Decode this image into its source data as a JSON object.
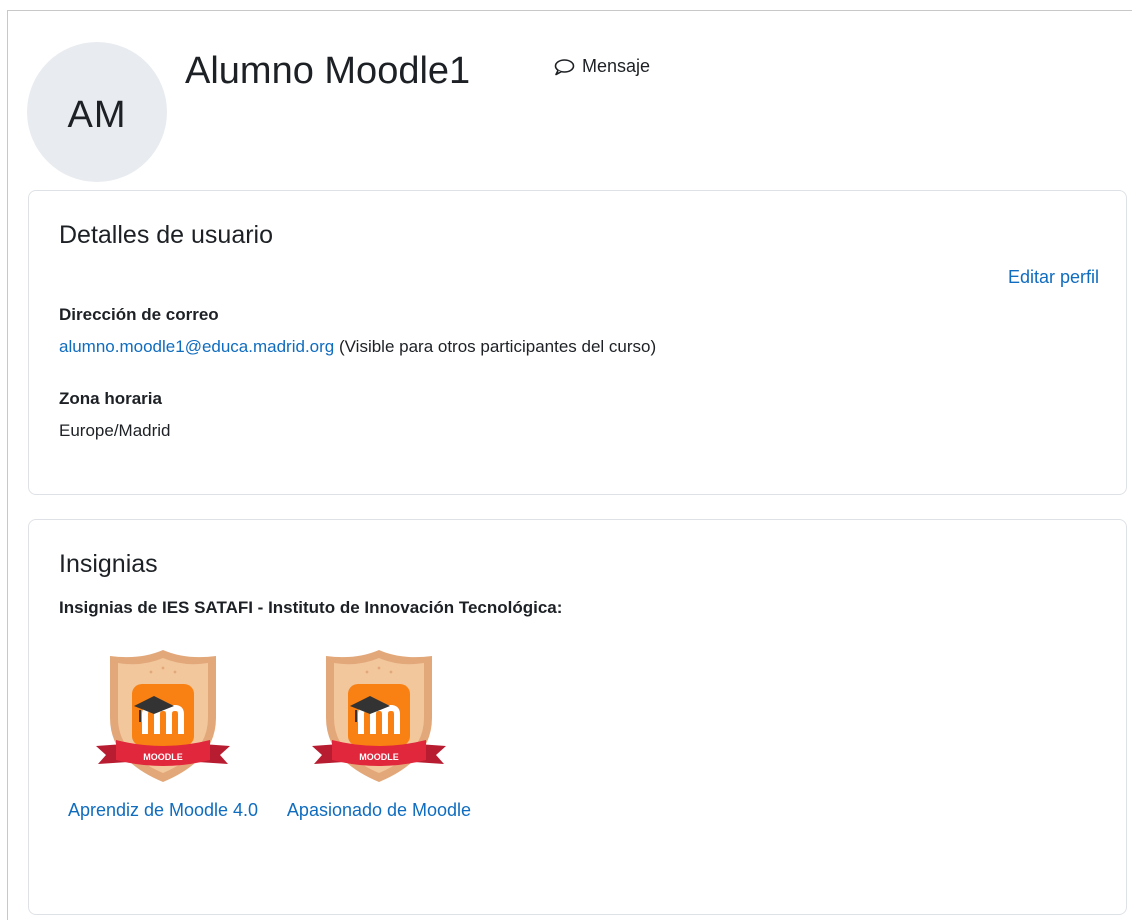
{
  "profile": {
    "initials": "AM",
    "fullname": "Alumno Moodle1",
    "message_label": "Mensaje"
  },
  "details": {
    "title": "Detalles de usuario",
    "edit_label": "Editar perfil",
    "email_label": "Dirección de correo",
    "email": "alumno.moodle1@educa.madrid.org",
    "email_note": " (Visible para otros participantes del curso)",
    "timezone_label": "Zona horaria",
    "timezone": "Europe/Madrid"
  },
  "badges": {
    "title": "Insignias",
    "heading": "Insignias de IES SATAFI - Instituto de Innovación Tecnológica:",
    "ribbon_text": "MOODLE",
    "items": [
      {
        "name": "Aprendiz de Moodle 4.0"
      },
      {
        "name": "Apasionado de Moodle"
      }
    ]
  },
  "colors": {
    "link": "#0f6cbf",
    "avatar_bg": "#e8ebef",
    "badge_orange": "#f98012",
    "badge_ribbon": "#e0273c",
    "badge_shield": "#f2c79c"
  }
}
